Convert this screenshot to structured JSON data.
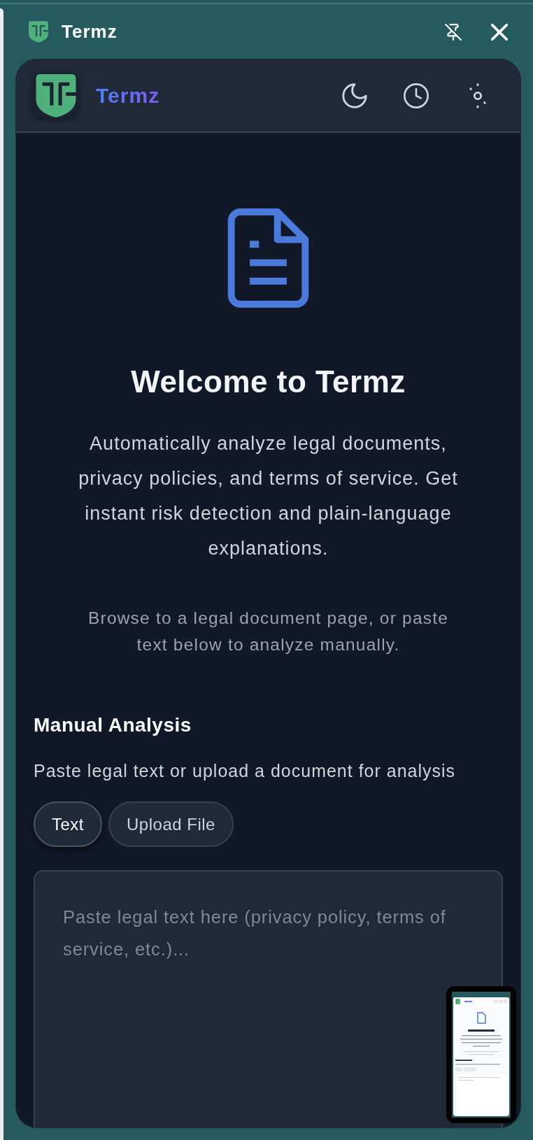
{
  "window": {
    "title": "Termz"
  },
  "header": {
    "app_name": "Termz"
  },
  "welcome": {
    "title": "Welcome to Termz",
    "description": "Automatically analyze legal documents, privacy policies, and terms of service. Get instant risk detection and plain-language explanations.",
    "hint": "Browse to a legal document page, or paste text below to analyze manually."
  },
  "manual_analysis": {
    "title": "Manual Analysis",
    "subtitle": "Paste legal text or upload a document for analysis",
    "tabs": [
      {
        "label": "Text",
        "selected": true
      },
      {
        "label": "Upload File",
        "selected": false
      }
    ],
    "text_input": {
      "placeholder": "Paste legal text here (privacy policy, terms of service, etc.)..."
    }
  }
}
